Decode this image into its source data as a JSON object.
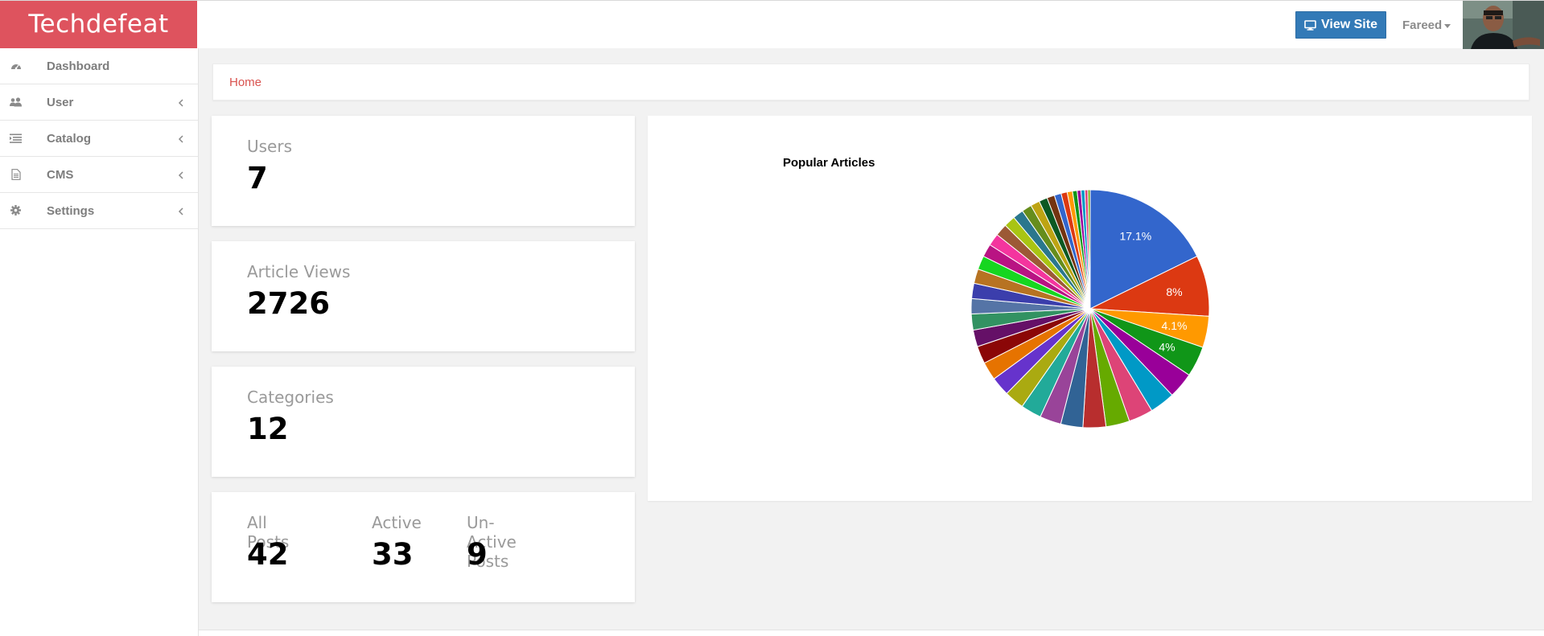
{
  "brand": {
    "title": "Techdefeat",
    "color": "#de535e"
  },
  "header": {
    "view_site_label": "View Site",
    "view_site_icon": "monitor-icon",
    "user_name": "Fareed"
  },
  "sidebar": {
    "items": [
      {
        "label": "Dashboard",
        "icon": "dashboard-icon",
        "has_submenu": false
      },
      {
        "label": "User",
        "icon": "users-icon",
        "has_submenu": true
      },
      {
        "label": "Catalog",
        "icon": "list-icon",
        "has_submenu": true
      },
      {
        "label": "CMS",
        "icon": "file-icon",
        "has_submenu": true
      },
      {
        "label": "Settings",
        "icon": "gear-icon",
        "has_submenu": true
      }
    ]
  },
  "breadcrumb": {
    "home": "Home"
  },
  "stats": {
    "users": {
      "label": "Users",
      "value": "7"
    },
    "article_views": {
      "label": "Article Views",
      "value": "2726"
    },
    "categories": {
      "label": "Categories",
      "value": "12"
    },
    "posts": {
      "all": {
        "label": "All Posts",
        "value": "42"
      },
      "active": {
        "label": "Active",
        "value": "33"
      },
      "inactive": {
        "label": "Un-Active Posts",
        "value": "9"
      }
    }
  },
  "chart_data": {
    "type": "pie",
    "title": "Popular Articles",
    "legend": "none",
    "values": [
      17.1,
      8,
      4.1,
      4,
      3.4,
      3.3,
      3.2,
      3.1,
      3.0,
      2.9,
      2.8,
      2.7,
      2.6,
      2.5,
      2.4,
      2.3,
      2.2,
      2.1,
      2.0,
      2.0,
      1.9,
      1.8,
      1.7,
      1.6,
      1.6,
      1.5,
      1.4,
      1.3,
      1.2,
      1.1,
      1.0,
      0.9,
      0.8,
      0.7,
      0.6,
      0.5,
      0.5,
      0.4,
      0.3
    ],
    "slice_labels": [
      "17.1%",
      "8%",
      "4.1%",
      "4%"
    ],
    "colors": [
      "#3366cc",
      "#dc3912",
      "#ff9900",
      "#109618",
      "#990099",
      "#0099c6",
      "#dd4477",
      "#66aa00",
      "#b82e2e",
      "#316395",
      "#994499",
      "#22aa99",
      "#aaaa11",
      "#6633cc",
      "#e67300",
      "#8b0707",
      "#651067",
      "#329262",
      "#5574a6",
      "#3b3eac",
      "#b77322",
      "#16d620",
      "#b91383",
      "#f4359e",
      "#9c5935",
      "#a9c413",
      "#2a778d",
      "#668d1c",
      "#bea413",
      "#0c5922",
      "#743411",
      "#3366cc",
      "#dc3912",
      "#ff9900",
      "#109618",
      "#990099",
      "#0099c6",
      "#dd4477",
      "#66aa00"
    ]
  }
}
